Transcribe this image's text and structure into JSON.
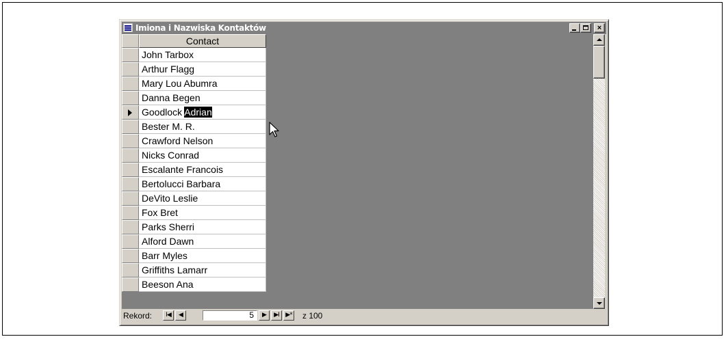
{
  "window": {
    "title": "Imiona i Nazwiska Kontaktów",
    "minimize_icon": "minimize-icon",
    "maximize_icon": "maximize-icon",
    "close_icon": "close-icon",
    "close_glyph": "×"
  },
  "datasheet": {
    "column_header": "Contact",
    "current_row_index": 4,
    "rows": [
      "John Tarbox",
      "Arthur Flagg",
      "Mary Lou Abumra",
      "Danna Begen",
      "Goodlock Adrian",
      "Bester M. R.",
      "Crawford Nelson",
      "Nicks Conrad",
      "Escalante Francois",
      "Bertolucci Barbara",
      "DeVito Leslie",
      "Fox Bret",
      "Parks Sherri",
      "Alford Dawn",
      "Barr Myles",
      "Griffiths Lamarr",
      "Beeson Ana"
    ],
    "current_row_prefix": "Goodlock ",
    "current_row_selected": "Adrian"
  },
  "navigation": {
    "label": "Rekord:",
    "first_glyph": "I◀",
    "prev_glyph": "◀",
    "record_value": "5",
    "next_glyph": "▶",
    "last_glyph": "▶I",
    "new_glyph": "▶*",
    "total": "z 100"
  }
}
